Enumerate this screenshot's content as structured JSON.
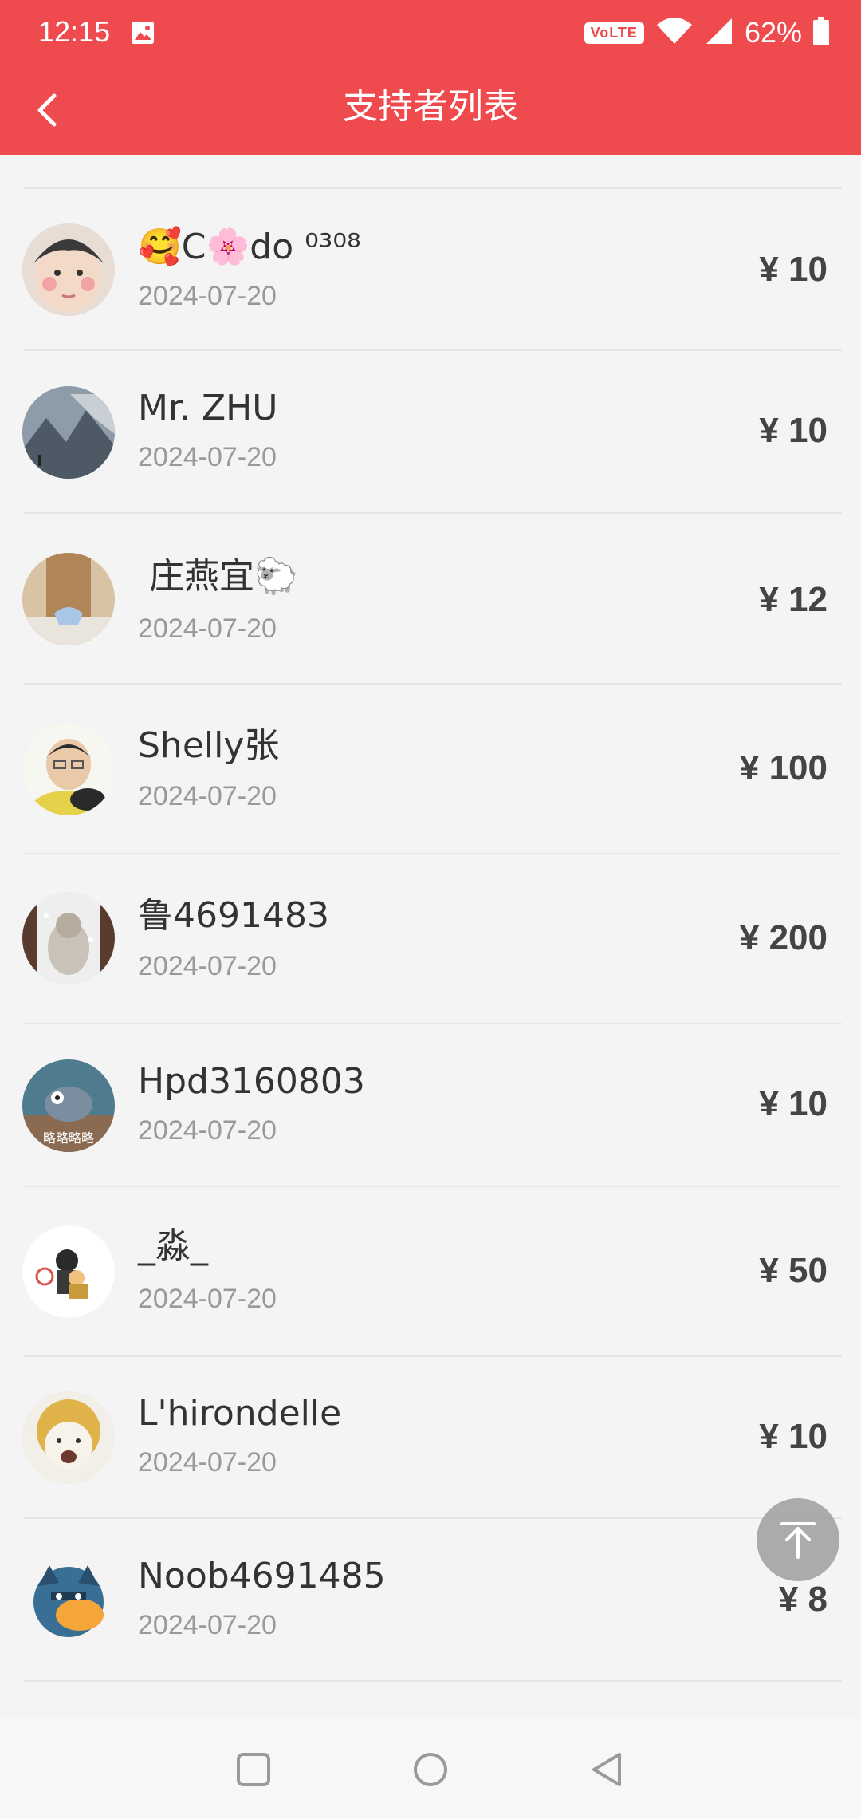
{
  "status_bar": {
    "time": "12:15",
    "volte": "VoLTE",
    "battery": "62%"
  },
  "header": {
    "title": "支持者列表",
    "back_icon": "chevron-left-icon"
  },
  "colors": {
    "brand": "#ef4a4e",
    "background": "#f4f4f4",
    "amount_text": "#444444",
    "date_text": "#999999"
  },
  "supporters": [
    {
      "name": "🥰C🌸do ⁰³⁰⁸",
      "date": "2024-07-20",
      "amount": "¥ 10"
    },
    {
      "name": "Mr. ZHU",
      "date": "2024-07-20",
      "amount": "¥ 10"
    },
    {
      "name": "￼ 庄燕宜🐑",
      "date": "2024-07-20",
      "amount": "¥ 12"
    },
    {
      "name": "Shelly张",
      "date": "2024-07-20",
      "amount": "¥ 100"
    },
    {
      "name": "鲁4691483",
      "date": "2024-07-20",
      "amount": "¥ 200"
    },
    {
      "name": "Hpd3160803",
      "date": "2024-07-20",
      "amount": "¥ 10"
    },
    {
      "name": "_淼_",
      "date": "2024-07-20",
      "amount": "¥ 50"
    },
    {
      "name": "L'hirondelle",
      "date": "2024-07-20",
      "amount": "¥ 10"
    },
    {
      "name": "Noob4691485",
      "date": "2024-07-20",
      "amount": "¥ 8"
    }
  ]
}
